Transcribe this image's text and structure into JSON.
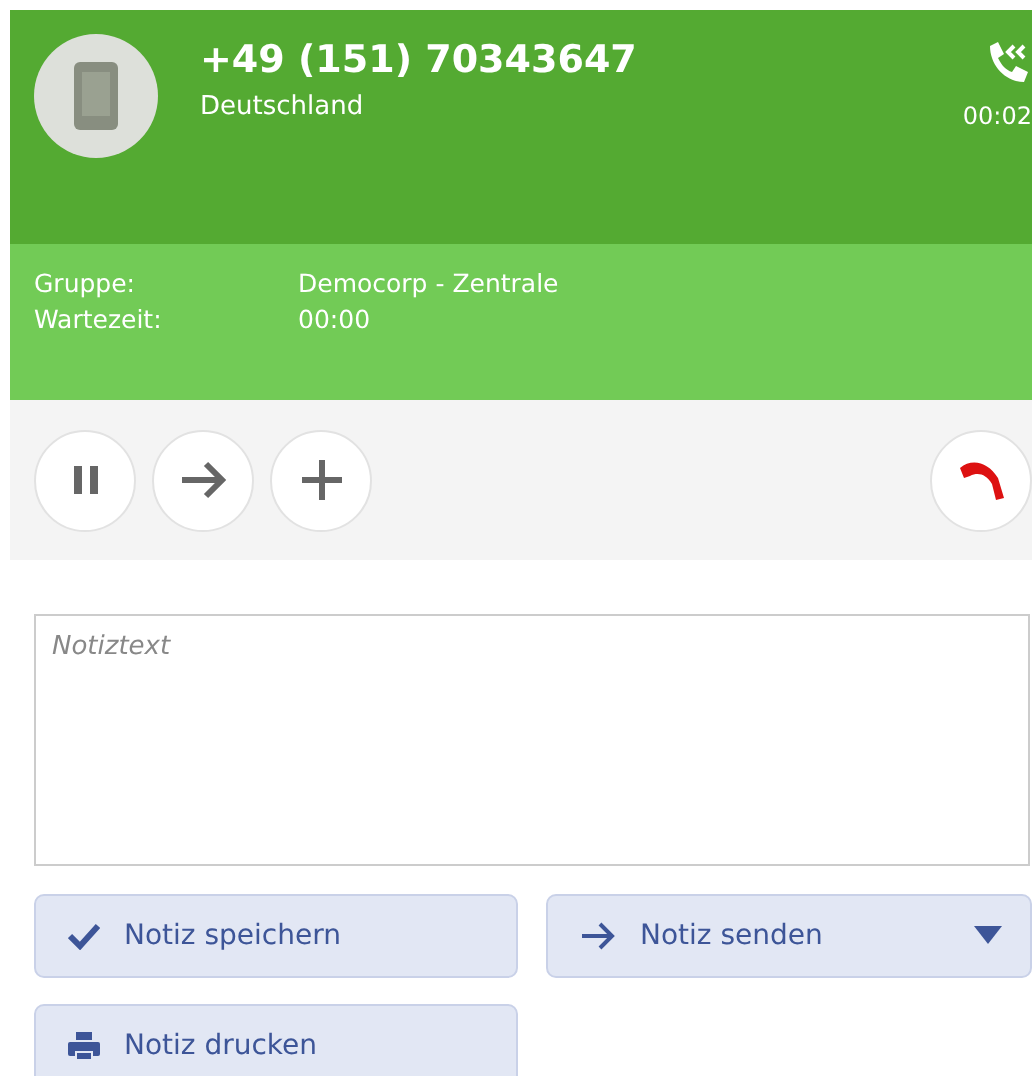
{
  "caller": {
    "number": "+49 (151) 70343647",
    "country": "Deutschland",
    "duration": "00:02"
  },
  "details": [
    {
      "label": "Gruppe:",
      "value": "Democorp - Zentrale"
    },
    {
      "label": "Wartezeit:",
      "value": "00:00"
    }
  ],
  "call_controls": [
    {
      "kind": "pause"
    },
    {
      "kind": "forward"
    },
    {
      "kind": "add"
    },
    {
      "kind": "hangup"
    }
  ],
  "note": {
    "placeholder": "Notiztext"
  },
  "note_actions": [
    {
      "kind": "save",
      "label": "Notiz speichern"
    },
    {
      "kind": "send",
      "label": "Notiz senden",
      "menu": true
    },
    {
      "kind": "print",
      "label": "Notiz drucken"
    }
  ]
}
